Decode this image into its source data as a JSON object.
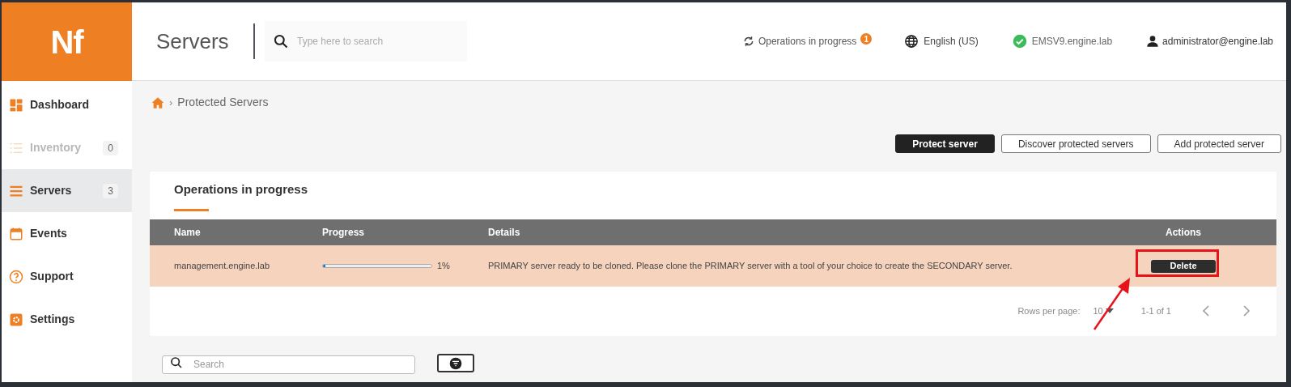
{
  "logo": {
    "text": "Nf"
  },
  "header": {
    "title": "Servers",
    "search": {
      "placeholder": "Type here to search"
    },
    "operations": {
      "label": "Operations in progress",
      "badge": "1"
    },
    "language": "English (US)",
    "server": {
      "name": "EMSV9.engine.lab",
      "connected": true
    },
    "user": "administrator@engine.lab"
  },
  "sidebar": {
    "items": [
      {
        "label": "Dashboard",
        "kind": "dashboard",
        "disabled": false,
        "selected": false
      },
      {
        "label": "Inventory",
        "kind": "list",
        "count": "0",
        "disabled": true,
        "selected": false
      },
      {
        "label": "Servers",
        "kind": "servers",
        "count": "3",
        "disabled": false,
        "selected": true
      },
      {
        "label": "Events",
        "kind": "calendar",
        "disabled": false,
        "selected": false
      },
      {
        "label": "Support",
        "kind": "help",
        "disabled": false,
        "selected": false
      },
      {
        "label": "Settings",
        "kind": "gear",
        "disabled": false,
        "selected": false
      }
    ]
  },
  "breadcrumb": {
    "separator": "›",
    "current": "Protected Servers"
  },
  "actions": [
    {
      "label": "Protect server",
      "primary": true
    },
    {
      "label": "Discover protected servers",
      "primary": false
    },
    {
      "label": "Add protected server",
      "primary": false
    }
  ],
  "operations_card": {
    "title": "Operations in progress",
    "table": {
      "columns": [
        "Name",
        "Progress",
        "Details",
        "Actions"
      ],
      "rows": [
        {
          "name": "management.engine.lab",
          "progress": {
            "level": 0.01,
            "reading": "1%"
          },
          "details": "PRIMARY server ready to be cloned. Please clone the PRIMARY server with a tool of your choice to create the SECONDARY server.",
          "action": "Delete",
          "highlighted": true
        }
      ]
    },
    "pagination": {
      "rows_per_page_label": "Rows per page:",
      "rows_per_page": "10",
      "range": "1-1 of 1"
    }
  },
  "filter": {
    "search": {
      "placeholder": "Search"
    }
  }
}
